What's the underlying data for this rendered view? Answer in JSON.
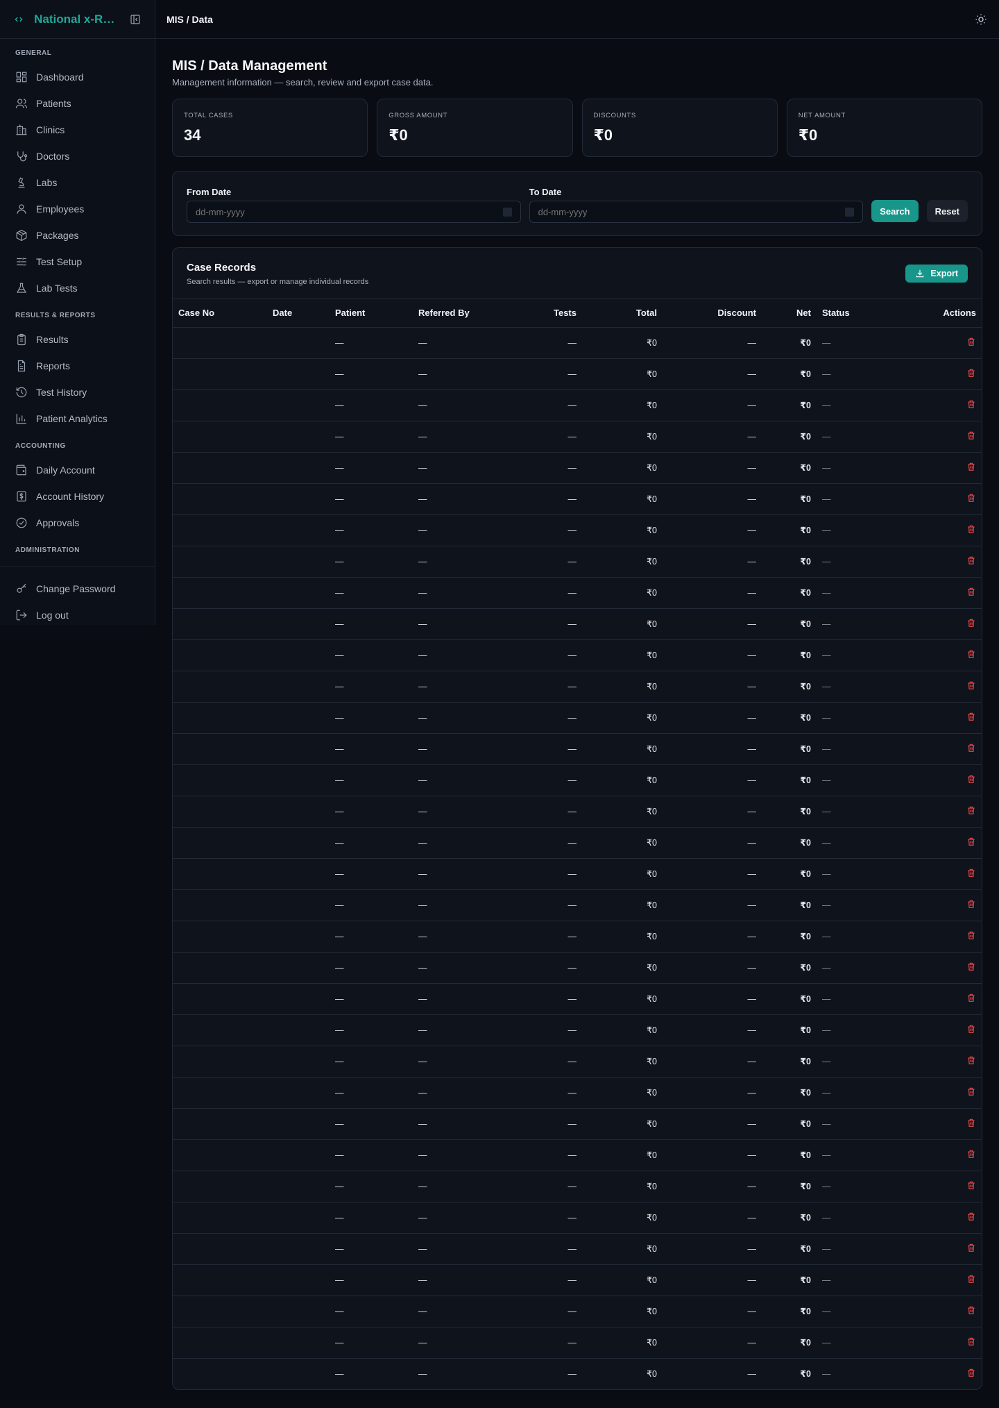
{
  "sidebar": {
    "brand": "National x-Ray Lab",
    "sections": [
      {
        "title": "GENERAL",
        "items": [
          {
            "label": "Dashboard",
            "icon": "dashboard-icon"
          },
          {
            "label": "Patients",
            "icon": "users-icon"
          },
          {
            "label": "Clinics",
            "icon": "hospital-icon"
          },
          {
            "label": "Doctors",
            "icon": "stethoscope-icon"
          },
          {
            "label": "Labs",
            "icon": "microscope-icon"
          },
          {
            "label": "Employees",
            "icon": "user-icon"
          },
          {
            "label": "Packages",
            "icon": "package-icon"
          },
          {
            "label": "Test Setup",
            "icon": "sliders-icon"
          },
          {
            "label": "Lab Tests",
            "icon": "flask-icon"
          }
        ]
      },
      {
        "title": "RESULTS & REPORTS",
        "items": [
          {
            "label": "Results",
            "icon": "clipboard-icon"
          },
          {
            "label": "Reports",
            "icon": "file-text-icon"
          },
          {
            "label": "Test History",
            "icon": "history-icon"
          },
          {
            "label": "Patient Analytics",
            "icon": "bar-chart-icon"
          }
        ]
      },
      {
        "title": "ACCOUNTING",
        "items": [
          {
            "label": "Daily Account",
            "icon": "wallet-icon"
          },
          {
            "label": "Account History",
            "icon": "dollar-receipt-icon"
          },
          {
            "label": "Approvals",
            "icon": "check-circle-icon"
          }
        ]
      },
      {
        "title": "ADMINISTRATION",
        "items": []
      }
    ],
    "footer_items": [
      {
        "label": "Change Password",
        "icon": "key-icon"
      },
      {
        "label": "Log out",
        "icon": "logout-icon"
      }
    ]
  },
  "topbar": {
    "breadcrumb": "MIS / Data"
  },
  "page": {
    "title": "MIS / Data Management",
    "subtitle": "Management information — search, review and export case data."
  },
  "stats": [
    {
      "label": "TOTAL CASES",
      "value": "34"
    },
    {
      "label": "GROSS AMOUNT",
      "value": "₹0"
    },
    {
      "label": "DISCOUNTS",
      "value": "₹0"
    },
    {
      "label": "NET AMOUNT",
      "value": "₹0"
    }
  ],
  "filter": {
    "from_label": "From Date",
    "from_placeholder": "dd-mm-yyyy",
    "to_label": "To Date",
    "to_placeholder": "dd-mm-yyyy",
    "search_label": "Search",
    "reset_label": "Reset"
  },
  "records": {
    "title": "Case Records",
    "subtitle": "Search results — export or manage individual records",
    "export_label": "Export",
    "columns": [
      "Case No",
      "Date",
      "Patient",
      "Referred By",
      "Tests",
      "Total",
      "Discount",
      "Net",
      "Status",
      "Actions"
    ],
    "row_count": 34,
    "row": {
      "case_no": "",
      "date": "",
      "patient": "—",
      "referred_by": "—",
      "tests": "—",
      "total": "₹0",
      "discount": "—",
      "net": "₹0",
      "status": "—"
    }
  }
}
